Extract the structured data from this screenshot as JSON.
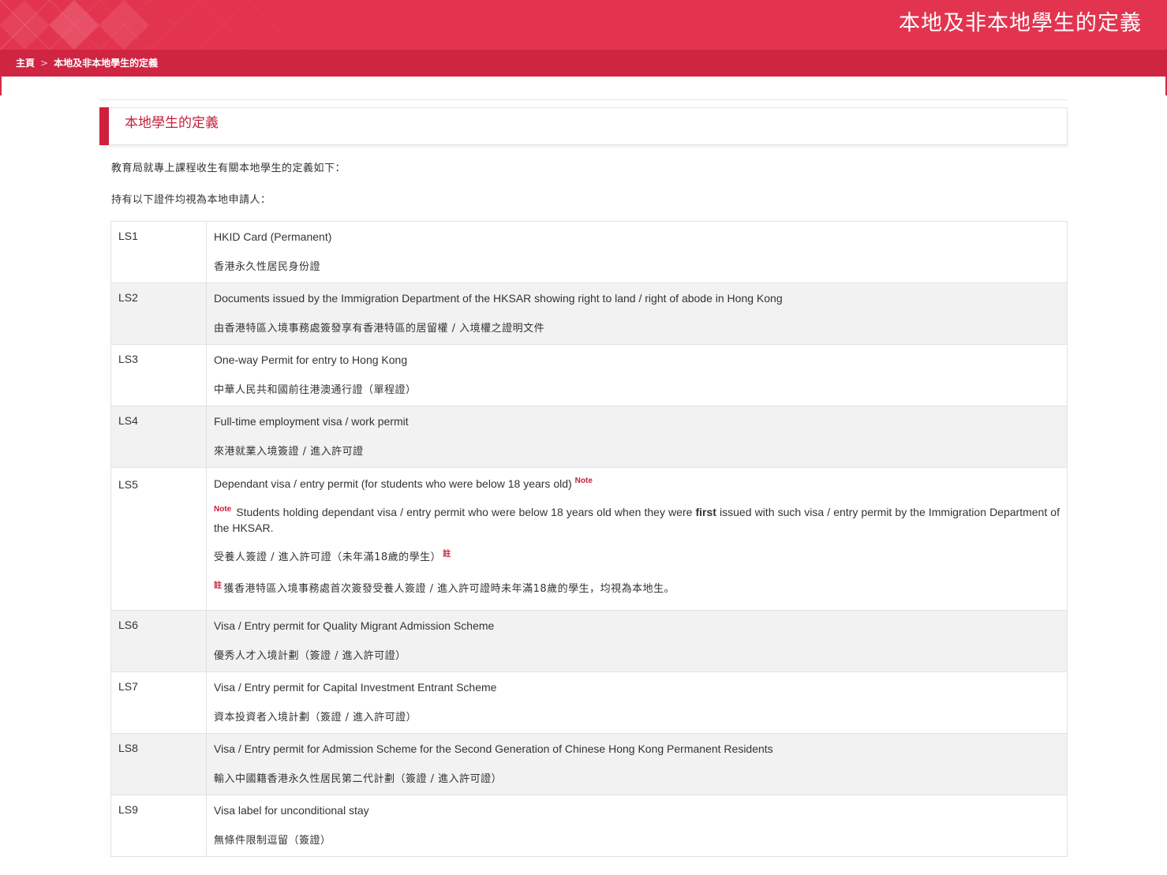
{
  "header": {
    "title": "本地及非本地學生的定義",
    "brand_color": "#e3344f"
  },
  "breadcrumb": {
    "home": "主頁",
    "separator": ">",
    "current": "本地及非本地學生的定義"
  },
  "section": {
    "title": "本地學生的定義",
    "intro": "教育局就專上課程收生有關本地學生的定義如下：",
    "lead": "持有以下證件均視為本地申請人："
  },
  "documents": [
    {
      "code": "LS1",
      "en": "HKID Card (Permanent)",
      "zh": "香港永久性居民身份證"
    },
    {
      "code": "LS2",
      "en": "Documents issued by the Immigration Department of the HKSAR showing right to land / right of abode in Hong Kong",
      "zh": "由香港特區入境事務處簽發享有香港特區的居留權 / 入境權之證明文件"
    },
    {
      "code": "LS3",
      "en": "One-way Permit for entry to Hong Kong",
      "zh": "中華人民共和國前往港澳通行證（單程證）"
    },
    {
      "code": "LS4",
      "en": "Full-time employment visa / work permit",
      "zh": "來港就業入境簽證 / 進入許可證"
    },
    {
      "code": "LS5",
      "en": "Dependant visa / entry permit (for students who were below 18 years old)",
      "en_note_mark": "Note",
      "note_en_before": "Students holding dependant visa / entry permit who were below 18 years old when they were ",
      "note_en_bold": "first",
      "note_en_after": " issued with such visa / entry permit by the Immigration Department of the HKSAR.",
      "zh": "受養人簽證 / 進入許可證（未年滿18歲的學生）",
      "zh_note_mark": "註",
      "note_zh": "獲香港特區入境事務處首次簽發受養人簽證 / 進入許可證時未年滿18歲的學生，均視為本地生。"
    },
    {
      "code": "LS6",
      "en": "Visa / Entry permit for Quality Migrant Admission Scheme",
      "zh": "優秀人才入境計劃（簽證 / 進入許可證）"
    },
    {
      "code": "LS7",
      "en": "Visa / Entry permit for Capital Investment Entrant Scheme",
      "zh": "資本投資者入境計劃（簽證 / 進入許可證）"
    },
    {
      "code": "LS8",
      "en": "Visa / Entry permit for Admission Scheme for the Second Generation of Chinese Hong Kong Permanent Residents",
      "zh": "輸入中國籍香港永久性居民第二代計劃（簽證 / 進入許可證）"
    },
    {
      "code": "LS9",
      "en": "Visa label for unconditional stay",
      "zh": "無條件限制逗留（簽證）"
    }
  ]
}
